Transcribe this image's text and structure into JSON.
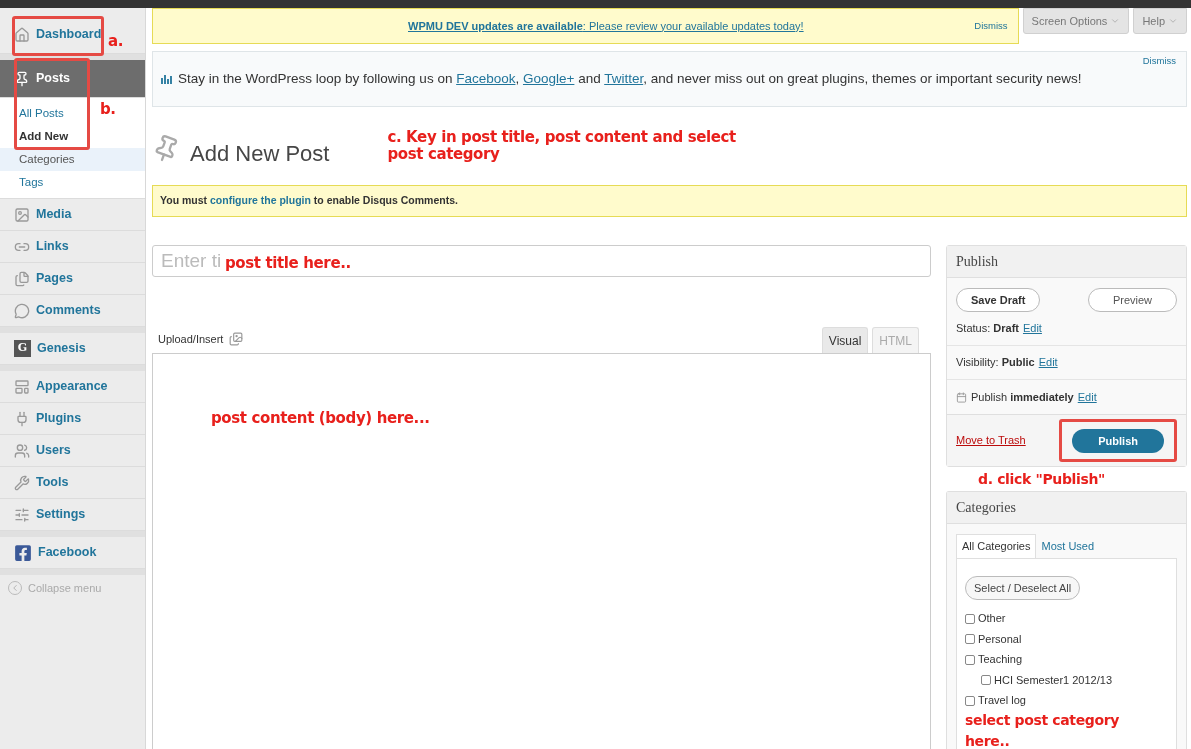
{
  "top_notice": {
    "parts": [
      {
        "kind": "strong_link",
        "text": "WPMU DEV updates are available"
      },
      {
        "kind": "link",
        "text": ": Please review your available updates today!"
      }
    ],
    "dismiss": "Dismiss"
  },
  "screen_meta": [
    {
      "label": "Screen Options"
    },
    {
      "label": "Help"
    }
  ],
  "sidebar": {
    "groups": [
      {
        "items": [
          {
            "label": "Dashboard",
            "selected": false
          }
        ]
      },
      {
        "items": [
          {
            "label": "Posts",
            "selected": true,
            "children": [
              {
                "label": "All Posts",
                "selected": false
              },
              {
                "label": "Add New",
                "selected": true
              },
              {
                "label": "Categories",
                "selected": false
              },
              {
                "label": "Tags",
                "selected": false
              }
            ]
          },
          {
            "label": "Media",
            "selected": false
          },
          {
            "label": "Links",
            "selected": false
          },
          {
            "label": "Pages",
            "selected": false
          },
          {
            "label": "Comments",
            "selected": false
          }
        ]
      },
      {
        "items": [
          {
            "label": "Genesis",
            "selected": false,
            "badge": "G"
          }
        ]
      },
      {
        "items": [
          {
            "label": "Appearance",
            "selected": false
          },
          {
            "label": "Plugins",
            "selected": false
          },
          {
            "label": "Users",
            "selected": false
          },
          {
            "label": "Tools",
            "selected": false
          },
          {
            "label": "Settings",
            "selected": false
          }
        ]
      },
      {
        "items": [
          {
            "label": "Facebook",
            "selected": false
          }
        ]
      }
    ],
    "collapse": "Collapse menu"
  },
  "loop_notice": {
    "parts": [
      {
        "kind": "text",
        "text": "Stay in the WordPress loop by following us on "
      },
      {
        "kind": "link",
        "text": "Facebook"
      },
      {
        "kind": "text",
        "text": ", "
      },
      {
        "kind": "link",
        "text": "Google+"
      },
      {
        "kind": "text",
        "text": " and "
      },
      {
        "kind": "link",
        "text": "Twitter"
      },
      {
        "kind": "text",
        "text": ", and never miss out on great plugins, themes or important security news!"
      }
    ],
    "dismiss": "Dismiss"
  },
  "page_title": "Add New Post",
  "disqus_notice": {
    "parts": [
      {
        "kind": "text",
        "text": "You must "
      },
      {
        "kind": "link",
        "text": "configure the plugin"
      },
      {
        "kind": "text",
        "text": " to enable Disqus Comments."
      }
    ]
  },
  "title_field": {
    "placeholder": "Enter ti"
  },
  "editor": {
    "upload_label": "Upload/Insert",
    "tabs": [
      {
        "label": "Visual",
        "selected": true
      },
      {
        "label": "HTML",
        "selected": false
      }
    ]
  },
  "publish_box": {
    "title": "Publish",
    "save_draft": "Save Draft",
    "preview": "Preview",
    "rows": [
      {
        "kind": "status",
        "text": "Status: **Draft**",
        "action": "Edit"
      },
      {
        "kind": "visibility",
        "text": "Visibility: **Public**",
        "action": "Edit"
      },
      {
        "kind": "schedule",
        "text": "Publish **immediately**",
        "action": "Edit"
      }
    ],
    "trash": "Move to Trash",
    "publish": "Publish"
  },
  "categories_box": {
    "title": "Categories",
    "tabs": [
      {
        "label": "All Categories",
        "selected": true
      },
      {
        "label": "Most Used",
        "selected": false
      }
    ],
    "select_all": "Select / Deselect All",
    "items": [
      {
        "label": "Other",
        "checked": false
      },
      {
        "label": "Personal",
        "checked": false
      },
      {
        "label": "Teaching",
        "checked": false,
        "children": [
          {
            "label": "HCI Semester1 2012/13",
            "checked": false
          }
        ]
      },
      {
        "label": "Travel log",
        "checked": false
      }
    ]
  },
  "annotations": {
    "dashboard": "a.",
    "posts": "b.",
    "step_c": "c. Key in post title, post content and select post category",
    "step_d": "d. click \"Publish\"",
    "title_hint": "post title here..",
    "content_hint": "post content (body) here...",
    "category_hint": "select post category here.."
  }
}
